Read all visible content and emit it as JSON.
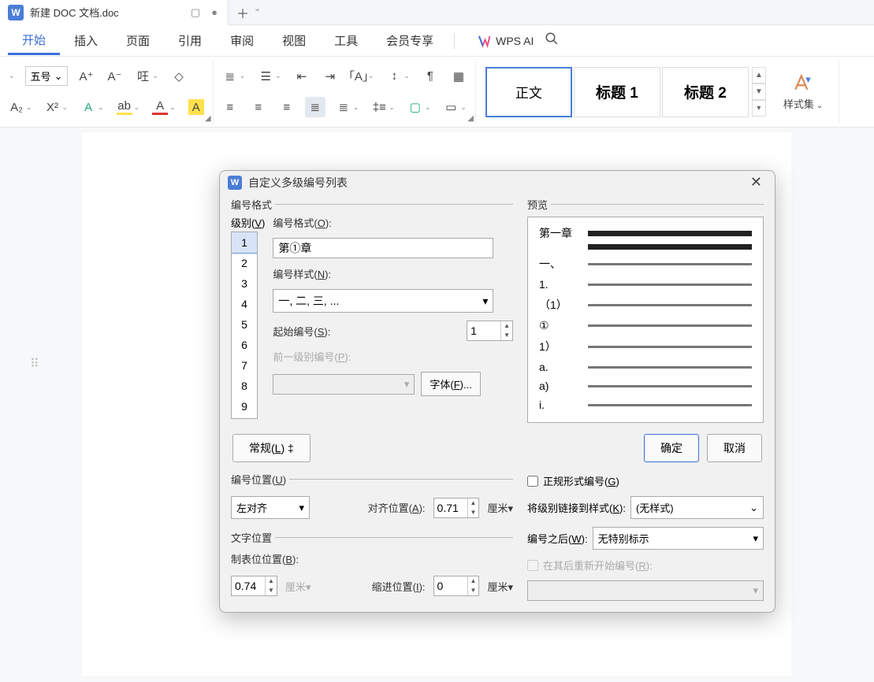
{
  "tab": {
    "app_badge": "W",
    "title": "新建 DOC 文档.doc"
  },
  "menu": {
    "items": [
      "开始",
      "插入",
      "页面",
      "引用",
      "审阅",
      "视图",
      "工具",
      "会员专享"
    ],
    "active_index": 0,
    "wps_ai": "WPS AI"
  },
  "ribbon": {
    "font_size": "五号",
    "styles": [
      "正文",
      "标题 1",
      "标题 2"
    ],
    "styleset_label": "样式集"
  },
  "dialog": {
    "title": "自定义多级编号列表",
    "number_format_group": "编号格式",
    "level_label": "级别(V)",
    "levels": [
      "1",
      "2",
      "3",
      "4",
      "5",
      "6",
      "7",
      "8",
      "9"
    ],
    "selected_level_index": 0,
    "fmt_label": "编号格式(O):",
    "fmt_value": "第①章",
    "style_label": "编号样式(N):",
    "style_value": "一, 二, 三, ...",
    "start_label": "起始编号(S):",
    "start_value": "1",
    "prev_level_label": "前一级别编号(P):",
    "font_btn": "字体(F)...",
    "normal_btn": "常规(L)",
    "ok_btn": "确定",
    "cancel_btn": "取消",
    "preview_label": "预览",
    "preview_items": [
      "第一章",
      "一、",
      "1.",
      "（1）",
      "①",
      "1）",
      "a.",
      "a)",
      "i."
    ],
    "pos_group": "编号位置(U)",
    "align_value": "左对齐",
    "align_pos_label": "对齐位置(A):",
    "align_pos_value": "0.71",
    "unit_cm": "厘米",
    "text_pos_group": "文字位置",
    "tab_pos_label": "制表位位置(B):",
    "tab_pos_value": "0.74",
    "indent_pos_label": "缩进位置(I):",
    "indent_pos_value": "0",
    "legal_chk": "正规形式编号(G)",
    "link_style_label": "将级别链接到样式(K):",
    "link_style_value": "(无样式)",
    "after_num_label": "编号之后(W):",
    "after_num_value": "无特别标示",
    "restart_after_label": "在其后重新开始编号(R):"
  }
}
